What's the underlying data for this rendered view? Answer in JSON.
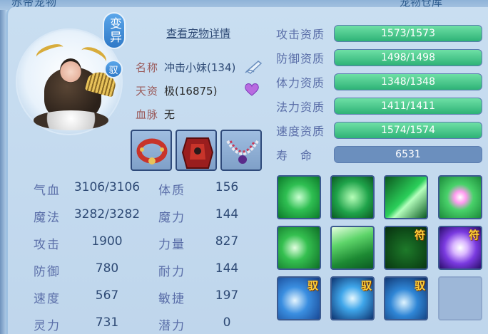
{
  "header": {
    "left_title": "赤帝宠物",
    "right_title": "宠物仓库"
  },
  "pet": {
    "variant_badge": "变异",
    "tame_badge": "驭",
    "detail_link": "查看宠物详情",
    "name_label": "名称",
    "name_value": "冲击小妹(134)",
    "talent_label": "天资",
    "talent_value": "极(16875)",
    "bloodline_label": "血脉",
    "bloodline_value": "无"
  },
  "equipment": [
    {
      "name": "collar",
      "icon": "red-collar-icon"
    },
    {
      "name": "armor",
      "icon": "red-armor-icon"
    },
    {
      "name": "necklace",
      "icon": "bead-necklace-icon"
    }
  ],
  "attributes_left": [
    {
      "label": "气血",
      "value": "3106/3106"
    },
    {
      "label": "魔法",
      "value": "3282/3282"
    },
    {
      "label": "攻击",
      "value": "1900"
    },
    {
      "label": "防御",
      "value": "780"
    },
    {
      "label": "速度",
      "value": "567"
    },
    {
      "label": "灵力",
      "value": "731"
    }
  ],
  "attributes_right": [
    {
      "label": "体质",
      "value": "156"
    },
    {
      "label": "魔力",
      "value": "144"
    },
    {
      "label": "力量",
      "value": "827"
    },
    {
      "label": "耐力",
      "value": "144"
    },
    {
      "label": "敏捷",
      "value": "197"
    },
    {
      "label": "潜力",
      "value": "0"
    }
  ],
  "aptitudes": [
    {
      "label": "攻击资质",
      "value": "1573/1573",
      "fill": 1.0
    },
    {
      "label": "防御资质",
      "value": "1498/1498",
      "fill": 1.0
    },
    {
      "label": "体力资质",
      "value": "1348/1348",
      "fill": 1.0
    },
    {
      "label": "法力资质",
      "value": "1411/1411",
      "fill": 1.0
    },
    {
      "label": "速度资质",
      "value": "1574/1574",
      "fill": 1.0
    }
  ],
  "lifespan": {
    "label": "寿　命",
    "value": "6531"
  },
  "skills": [
    {
      "icon": "wings-skill-icon",
      "tag": ""
    },
    {
      "icon": "horse-skill-icon",
      "tag": ""
    },
    {
      "icon": "light-beam-skill-icon",
      "tag": ""
    },
    {
      "icon": "heart-skill-icon",
      "tag": ""
    },
    {
      "icon": "fist-skill-icon",
      "tag": ""
    },
    {
      "icon": "burst-skill-icon",
      "tag": ""
    },
    {
      "icon": "muscle-skill-icon",
      "tag": "符"
    },
    {
      "icon": "purple-burst-skill-icon",
      "tag": "符"
    },
    {
      "icon": "ice-claw-skill-icon",
      "tag": "驭"
    },
    {
      "icon": "ice-shard-skill-icon",
      "tag": "驭"
    },
    {
      "icon": "ice-crystal-skill-icon",
      "tag": "驭"
    },
    {
      "icon": "",
      "tag": ""
    }
  ],
  "colors": {
    "green_bar": "#2eb277",
    "blue_bar": "#6b8fbe",
    "tag_gold": "#ffd13a"
  }
}
